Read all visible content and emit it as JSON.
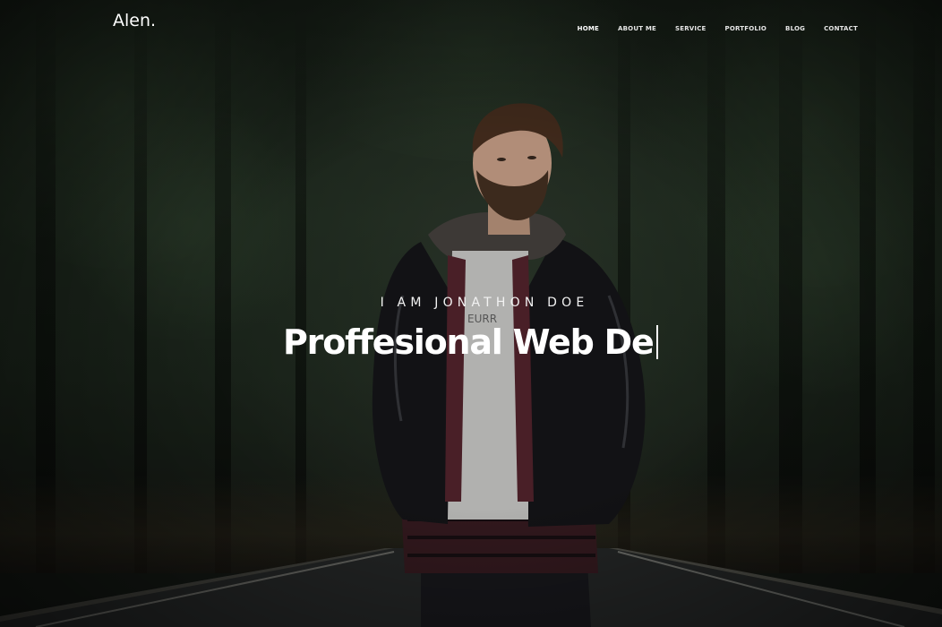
{
  "header": {
    "logo": "Alen.",
    "nav": [
      {
        "label": "HOME",
        "active": true
      },
      {
        "label": "ABOUT ME",
        "active": false
      },
      {
        "label": "SERVICE",
        "active": false
      },
      {
        "label": "PORTFOLIO",
        "active": false
      },
      {
        "label": "BLOG",
        "active": false
      },
      {
        "label": "CONTACT",
        "active": false
      }
    ]
  },
  "hero": {
    "intro": "I AM JONATHON DOE",
    "headline": "Proffesional Web De",
    "shirt_text": "EURR"
  }
}
